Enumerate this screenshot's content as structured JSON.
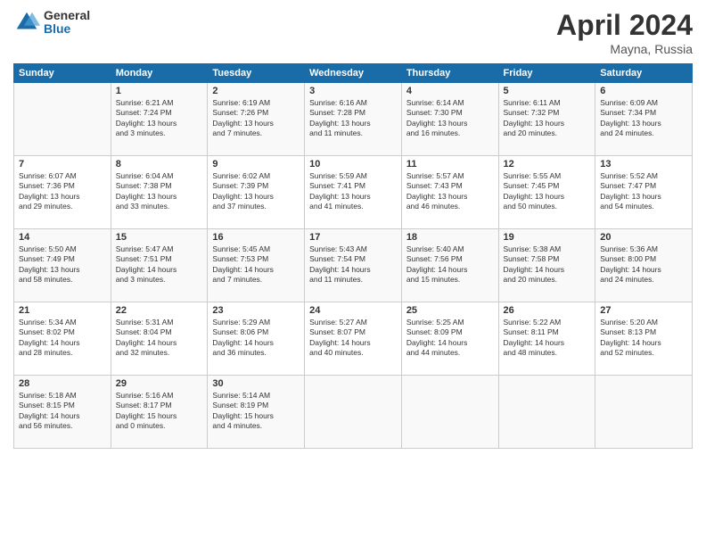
{
  "logo": {
    "general": "General",
    "blue": "Blue"
  },
  "title": {
    "month": "April 2024",
    "location": "Mayna, Russia"
  },
  "days_of_week": [
    "Sunday",
    "Monday",
    "Tuesday",
    "Wednesday",
    "Thursday",
    "Friday",
    "Saturday"
  ],
  "weeks": [
    [
      {
        "day": "",
        "info": ""
      },
      {
        "day": "1",
        "info": "Sunrise: 6:21 AM\nSunset: 7:24 PM\nDaylight: 13 hours\nand 3 minutes."
      },
      {
        "day": "2",
        "info": "Sunrise: 6:19 AM\nSunset: 7:26 PM\nDaylight: 13 hours\nand 7 minutes."
      },
      {
        "day": "3",
        "info": "Sunrise: 6:16 AM\nSunset: 7:28 PM\nDaylight: 13 hours\nand 11 minutes."
      },
      {
        "day": "4",
        "info": "Sunrise: 6:14 AM\nSunset: 7:30 PM\nDaylight: 13 hours\nand 16 minutes."
      },
      {
        "day": "5",
        "info": "Sunrise: 6:11 AM\nSunset: 7:32 PM\nDaylight: 13 hours\nand 20 minutes."
      },
      {
        "day": "6",
        "info": "Sunrise: 6:09 AM\nSunset: 7:34 PM\nDaylight: 13 hours\nand 24 minutes."
      }
    ],
    [
      {
        "day": "7",
        "info": "Sunrise: 6:07 AM\nSunset: 7:36 PM\nDaylight: 13 hours\nand 29 minutes."
      },
      {
        "day": "8",
        "info": "Sunrise: 6:04 AM\nSunset: 7:38 PM\nDaylight: 13 hours\nand 33 minutes."
      },
      {
        "day": "9",
        "info": "Sunrise: 6:02 AM\nSunset: 7:39 PM\nDaylight: 13 hours\nand 37 minutes."
      },
      {
        "day": "10",
        "info": "Sunrise: 5:59 AM\nSunset: 7:41 PM\nDaylight: 13 hours\nand 41 minutes."
      },
      {
        "day": "11",
        "info": "Sunrise: 5:57 AM\nSunset: 7:43 PM\nDaylight: 13 hours\nand 46 minutes."
      },
      {
        "day": "12",
        "info": "Sunrise: 5:55 AM\nSunset: 7:45 PM\nDaylight: 13 hours\nand 50 minutes."
      },
      {
        "day": "13",
        "info": "Sunrise: 5:52 AM\nSunset: 7:47 PM\nDaylight: 13 hours\nand 54 minutes."
      }
    ],
    [
      {
        "day": "14",
        "info": "Sunrise: 5:50 AM\nSunset: 7:49 PM\nDaylight: 13 hours\nand 58 minutes."
      },
      {
        "day": "15",
        "info": "Sunrise: 5:47 AM\nSunset: 7:51 PM\nDaylight: 14 hours\nand 3 minutes."
      },
      {
        "day": "16",
        "info": "Sunrise: 5:45 AM\nSunset: 7:53 PM\nDaylight: 14 hours\nand 7 minutes."
      },
      {
        "day": "17",
        "info": "Sunrise: 5:43 AM\nSunset: 7:54 PM\nDaylight: 14 hours\nand 11 minutes."
      },
      {
        "day": "18",
        "info": "Sunrise: 5:40 AM\nSunset: 7:56 PM\nDaylight: 14 hours\nand 15 minutes."
      },
      {
        "day": "19",
        "info": "Sunrise: 5:38 AM\nSunset: 7:58 PM\nDaylight: 14 hours\nand 20 minutes."
      },
      {
        "day": "20",
        "info": "Sunrise: 5:36 AM\nSunset: 8:00 PM\nDaylight: 14 hours\nand 24 minutes."
      }
    ],
    [
      {
        "day": "21",
        "info": "Sunrise: 5:34 AM\nSunset: 8:02 PM\nDaylight: 14 hours\nand 28 minutes."
      },
      {
        "day": "22",
        "info": "Sunrise: 5:31 AM\nSunset: 8:04 PM\nDaylight: 14 hours\nand 32 minutes."
      },
      {
        "day": "23",
        "info": "Sunrise: 5:29 AM\nSunset: 8:06 PM\nDaylight: 14 hours\nand 36 minutes."
      },
      {
        "day": "24",
        "info": "Sunrise: 5:27 AM\nSunset: 8:07 PM\nDaylight: 14 hours\nand 40 minutes."
      },
      {
        "day": "25",
        "info": "Sunrise: 5:25 AM\nSunset: 8:09 PM\nDaylight: 14 hours\nand 44 minutes."
      },
      {
        "day": "26",
        "info": "Sunrise: 5:22 AM\nSunset: 8:11 PM\nDaylight: 14 hours\nand 48 minutes."
      },
      {
        "day": "27",
        "info": "Sunrise: 5:20 AM\nSunset: 8:13 PM\nDaylight: 14 hours\nand 52 minutes."
      }
    ],
    [
      {
        "day": "28",
        "info": "Sunrise: 5:18 AM\nSunset: 8:15 PM\nDaylight: 14 hours\nand 56 minutes."
      },
      {
        "day": "29",
        "info": "Sunrise: 5:16 AM\nSunset: 8:17 PM\nDaylight: 15 hours\nand 0 minutes."
      },
      {
        "day": "30",
        "info": "Sunrise: 5:14 AM\nSunset: 8:19 PM\nDaylight: 15 hours\nand 4 minutes."
      },
      {
        "day": "",
        "info": ""
      },
      {
        "day": "",
        "info": ""
      },
      {
        "day": "",
        "info": ""
      },
      {
        "day": "",
        "info": ""
      }
    ]
  ]
}
